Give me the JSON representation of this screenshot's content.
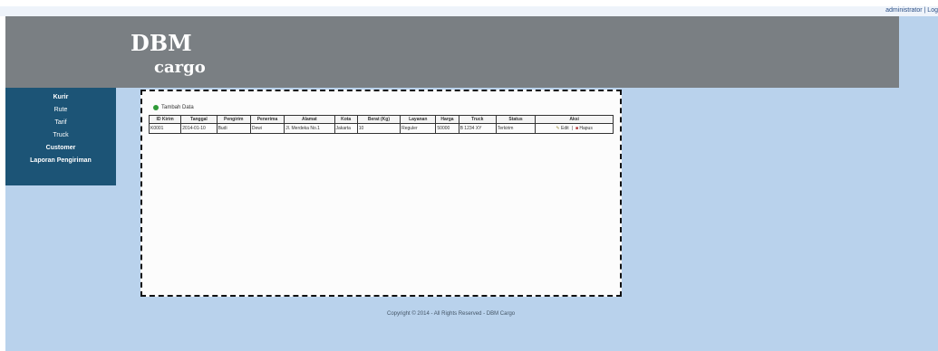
{
  "top_right": {
    "user_text": "administrator | Log"
  },
  "header": {
    "logo_line1": "DBM",
    "logo_line2": "cargo"
  },
  "sidebar": {
    "items": [
      {
        "label": "Kurir"
      },
      {
        "label": "Rute"
      },
      {
        "label": "Tarif"
      },
      {
        "label": "Truck"
      },
      {
        "label": "Customer"
      },
      {
        "label": "Laporan Pengiriman"
      }
    ]
  },
  "content": {
    "add_link_label": "Tambah Data",
    "table": {
      "columns": [
        "ID Kirim",
        "Tanggal",
        "Pengirim",
        "Penerima",
        "Alamat",
        "Kota",
        "Berat (Kg)",
        "Layanan",
        "Harga",
        "Truck",
        "Status",
        "Aksi"
      ],
      "rows": [
        {
          "cells": [
            "K0001",
            "2014-01-10",
            "Budi",
            "Dewi",
            "Jl. Merdeka No.1",
            "Jakarta",
            "10",
            "Reguler",
            "50000",
            "B 1234 XY",
            "Terkirim",
            ""
          ],
          "edit_label": "Edit",
          "delete_label": "Hapus"
        }
      ]
    }
  },
  "footer": {
    "text": "Copyright © 2014 - All Rights Reserved - DBM Cargo"
  },
  "colors": {
    "header_bg": "#7a7f83",
    "sidebar_bg": "#1c5476",
    "page_bg": "#b9d2ec",
    "panel_bg": "#fcfcfc",
    "accent_green": "#2f9a37"
  },
  "icons": {
    "add": "plus-circle-icon",
    "edit": "pencil-icon",
    "delete": "trash-icon"
  }
}
